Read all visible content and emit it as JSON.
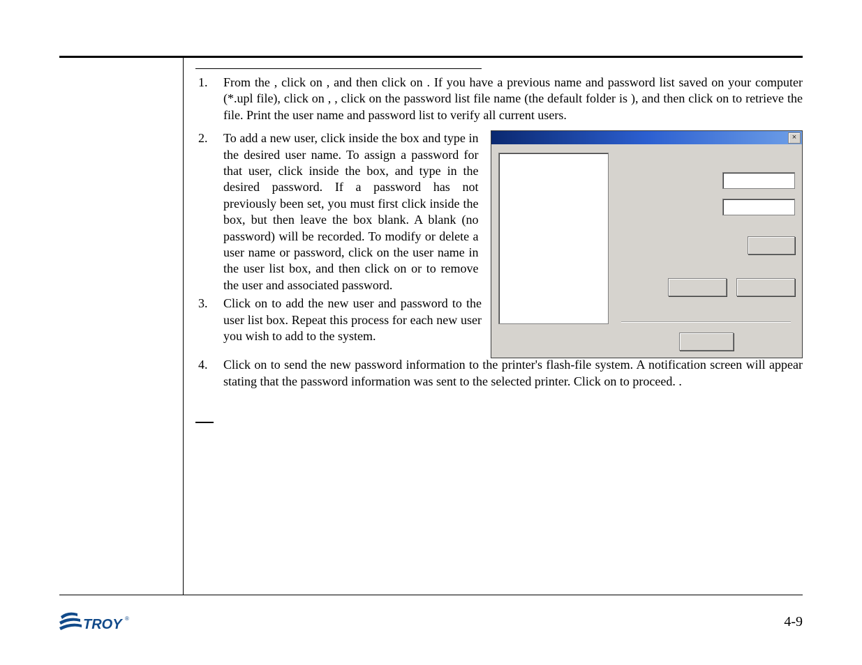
{
  "steps": {
    "s1": "From the                       , click on            , and then click on                                 .  If you have a previous name and password list saved on your computer (*.upl file), click on       ,         , click on the password list file name (the default folder is               ), and then click on           to retrieve the file.  Print the user name and password list to verify all current users.",
    "s2": "To add a new user, click inside the           box and type in the desired user name.  To assign a password for that user, click inside the               box, and type in the desired password.  If a password has not previously been set, you must first click inside the               box, but then leave the           box blank.  A blank (no password) will be recorded.  To modify or delete a user name or password, click on the user name in the user list box, and then click on             or             to remove the user and associated password.",
    "s3": "Click on                       to add the new user and password to the user list box.  Repeat this process for each new user you wish to add to the system.",
    "s4": "Click on                           to send the new password information to the printer's flash-file system.  A notification screen will appear stating that the password information was sent to the selected printer.  Click on        to proceed.                                                                                                                                            ."
  },
  "dialog": {
    "close_glyph": "×"
  },
  "footer": {
    "page_number": "4-9",
    "brand": "TROY"
  }
}
